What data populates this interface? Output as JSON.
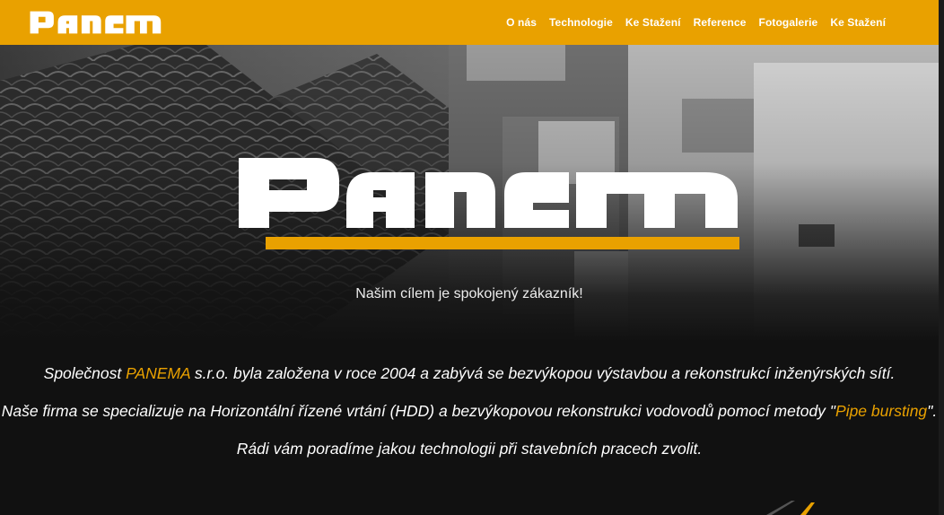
{
  "brand": {
    "name": "PANEMA",
    "accent_color": "#e9a100"
  },
  "nav": {
    "items": [
      {
        "label": "O nás"
      },
      {
        "label": "Technologie"
      },
      {
        "label": "Ke Stažení"
      },
      {
        "label": "Reference"
      },
      {
        "label": "Fotogalerie"
      },
      {
        "label": "Ke Stažení"
      }
    ]
  },
  "hero": {
    "tagline": "Našim cílem je spokojený zákazník!"
  },
  "intro": {
    "p1_before": "Společnost ",
    "p1_brand": "PANEMA",
    "p1_after": " s.r.o. byla založena v roce 2004 a zabývá se bezvýkopou výstavbou a rekonstrukcí inženýrských sítí.",
    "p2_before": "Naše firma se specializuje na Horizontální řízené vrtání (HDD) a bezvýkopovou rekonstrukci vodovodů pomocí metody  \"",
    "p2_link": "Pipe bursting",
    "p2_after": "\".",
    "p3": "Rádi vám poradíme jakou technologii při stavebních pracech zvolit."
  }
}
